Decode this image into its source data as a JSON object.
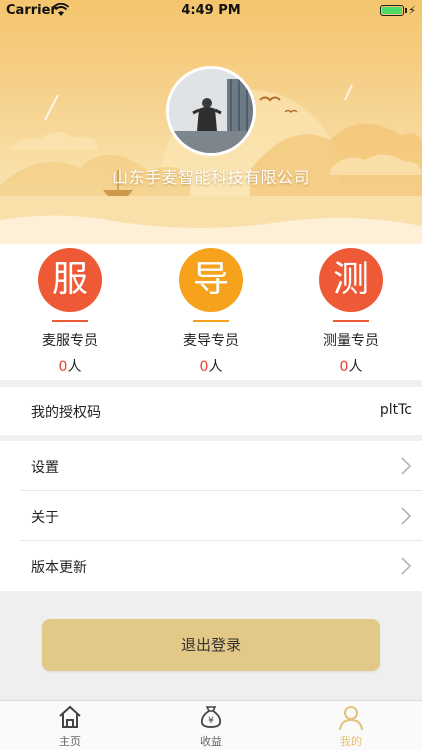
{
  "status_bar": {
    "carrier": "Carrier",
    "time": "4:49 PM"
  },
  "profile": {
    "company_name": "山东手麦智能科技有限公司"
  },
  "roles": [
    {
      "glyph": "服",
      "title": "麦服专员",
      "count": "0",
      "unit": "人",
      "color": "#ee5a36",
      "line_color": "#ee5a36"
    },
    {
      "glyph": "导",
      "title": "麦导专员",
      "count": "0",
      "unit": "人",
      "color": "#f7a21c",
      "line_color": "#f7a21c"
    },
    {
      "glyph": "测",
      "title": "测量专员",
      "count": "0",
      "unit": "人",
      "color": "#ee5a36",
      "line_color": "#ee5a36"
    }
  ],
  "auth_code": {
    "label": "我的授权码",
    "value": "pltTc"
  },
  "menu": [
    {
      "label": "设置"
    },
    {
      "label": "关于"
    },
    {
      "label": "版本更新"
    }
  ],
  "logout": {
    "label": "退出登录"
  },
  "tabs": [
    {
      "label": "主页",
      "icon": "home-icon",
      "active": false
    },
    {
      "label": "收益",
      "icon": "money-bag-icon",
      "active": false
    },
    {
      "label": "我的",
      "icon": "person-icon",
      "active": true
    }
  ],
  "colors": {
    "accent": "#e3c27a",
    "button": "#e3c988",
    "count": "#e8412c"
  }
}
